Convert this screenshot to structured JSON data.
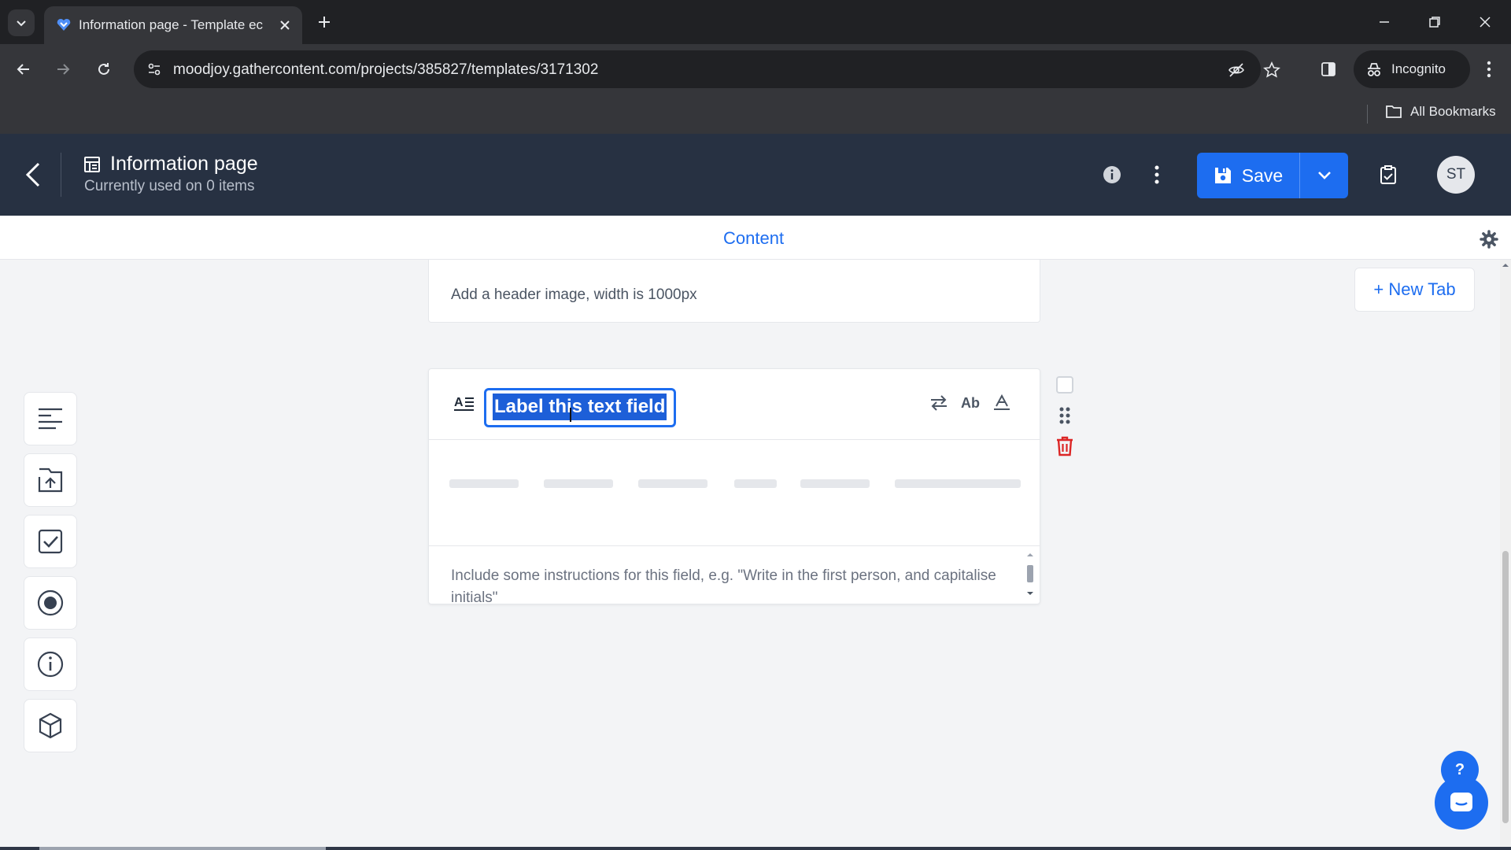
{
  "browser": {
    "tab_title": "Information page - Template ec",
    "url": "moodjoy.gathercontent.com/projects/385827/templates/3171302",
    "incognito_label": "Incognito",
    "bookmarks_label": "All Bookmarks"
  },
  "header": {
    "title": "Information page",
    "subtitle": "Currently used on 0 items",
    "save_label": "Save",
    "avatar_initials": "ST"
  },
  "tabs": {
    "content_label": "Content",
    "new_tab_label": "+ New Tab"
  },
  "fields": {
    "image_field_instructions": "Add a header image, width is 1000px",
    "text_field": {
      "label": "Label this text field",
      "instructions": "Include some instructions for this field, e.g. \"Write in the first person, and capitalise initials\"",
      "format_tool_label": "Ab"
    }
  },
  "palette": {
    "items": [
      "text-field-icon",
      "upload-icon",
      "checkbox-icon",
      "radio-icon",
      "guideline-icon",
      "component-icon"
    ]
  },
  "help": {
    "label": "?"
  },
  "colors": {
    "accent": "#1d6df0",
    "header_bg": "#273142",
    "danger": "#dc2626"
  }
}
